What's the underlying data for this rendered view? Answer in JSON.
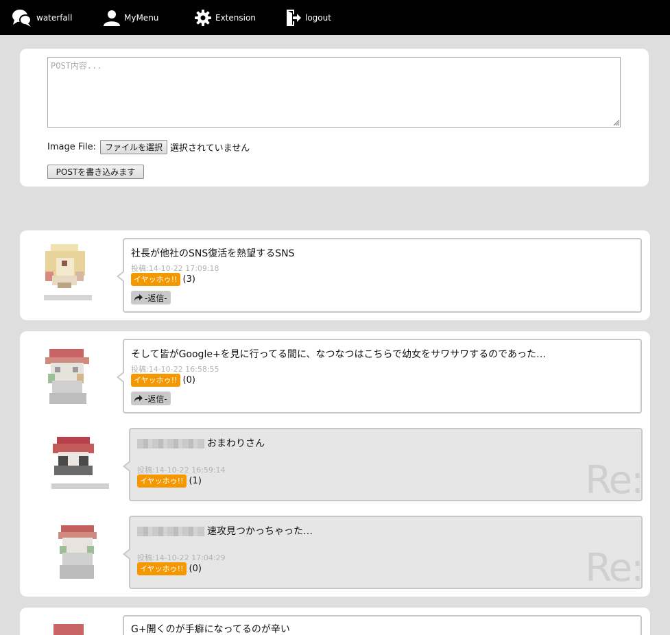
{
  "nav": {
    "items": [
      {
        "label": "waterfall",
        "icon": "chat-bubbles-icon"
      },
      {
        "label": "MyMenu",
        "icon": "user-icon"
      },
      {
        "label": "Extension",
        "icon": "gear-icon"
      },
      {
        "label": "logout",
        "icon": "logout-icon"
      }
    ]
  },
  "compose": {
    "placeholder": "POST内容...",
    "file_label": "Image File:",
    "file_button": "ファイルを選択",
    "file_status": "選択されていません",
    "submit_label": "POSTを書き込みます"
  },
  "posts": [
    {
      "text": "社長が他社のSNS復活を熱望するSNS",
      "date": "投稿:14-10-22 17:09:18",
      "like_label": "イヤッホゥ!!",
      "like_count": "(3)",
      "reply_label": "-返信-"
    },
    {
      "text": "そして皆がGoogle+を見に行ってる間に、なつなつはこちらで幼女をサワサワするのであった…",
      "date": "投稿:14-10-22 16:58:55",
      "like_label": "イヤッホゥ!!",
      "like_count": "(0)",
      "reply_label": "-返信-",
      "replies": [
        {
          "text": "おまわりさん",
          "date": "投稿:14-10-22 16:59:14",
          "like_label": "イヤッホゥ!!",
          "like_count": "(1)",
          "mark": "Re:"
        },
        {
          "text": "速攻見つかっちゃった…",
          "date": "投稿:14-10-22 17:04:29",
          "like_label": "イヤッホゥ!!",
          "like_count": "(0)",
          "mark": "Re:"
        }
      ]
    },
    {
      "text": "G+開くのが手癖になってるのが辛い"
    }
  ],
  "colors": {
    "nav_bg": "#000000",
    "page_bg": "#dedede",
    "like_orange": "#f39800",
    "reply_bg": "#e6e6e6"
  }
}
